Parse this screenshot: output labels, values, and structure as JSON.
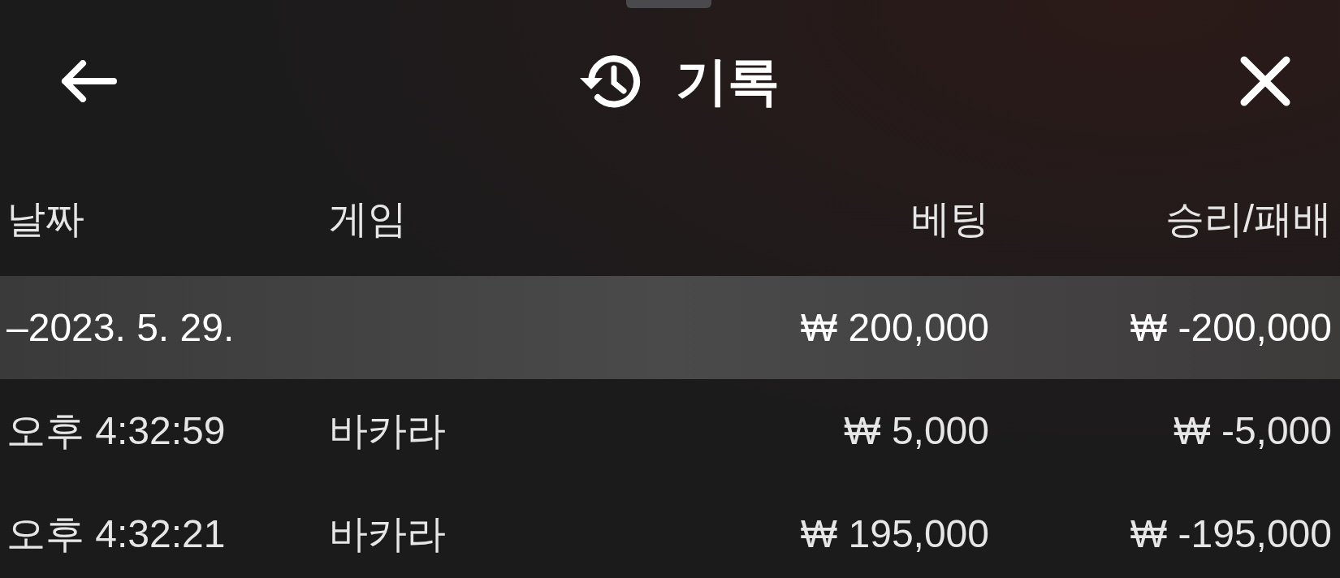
{
  "header": {
    "title": "기록"
  },
  "columns": [
    {
      "label": "날짜"
    },
    {
      "label": "게임"
    },
    {
      "label": "베팅"
    },
    {
      "label": "승리/패배"
    }
  ],
  "summary": {
    "date": "–2023. 5. 29.",
    "bet": "₩ 200,000",
    "result": "₩ -200,000"
  },
  "rows": [
    {
      "time": "오후 4:32:59",
      "game": "바카라",
      "bet": "₩ 5,000",
      "result": "₩ -5,000"
    },
    {
      "time": "오후 4:32:21",
      "game": "바카라",
      "bet": "₩ 195,000",
      "result": "₩ -195,000"
    }
  ]
}
